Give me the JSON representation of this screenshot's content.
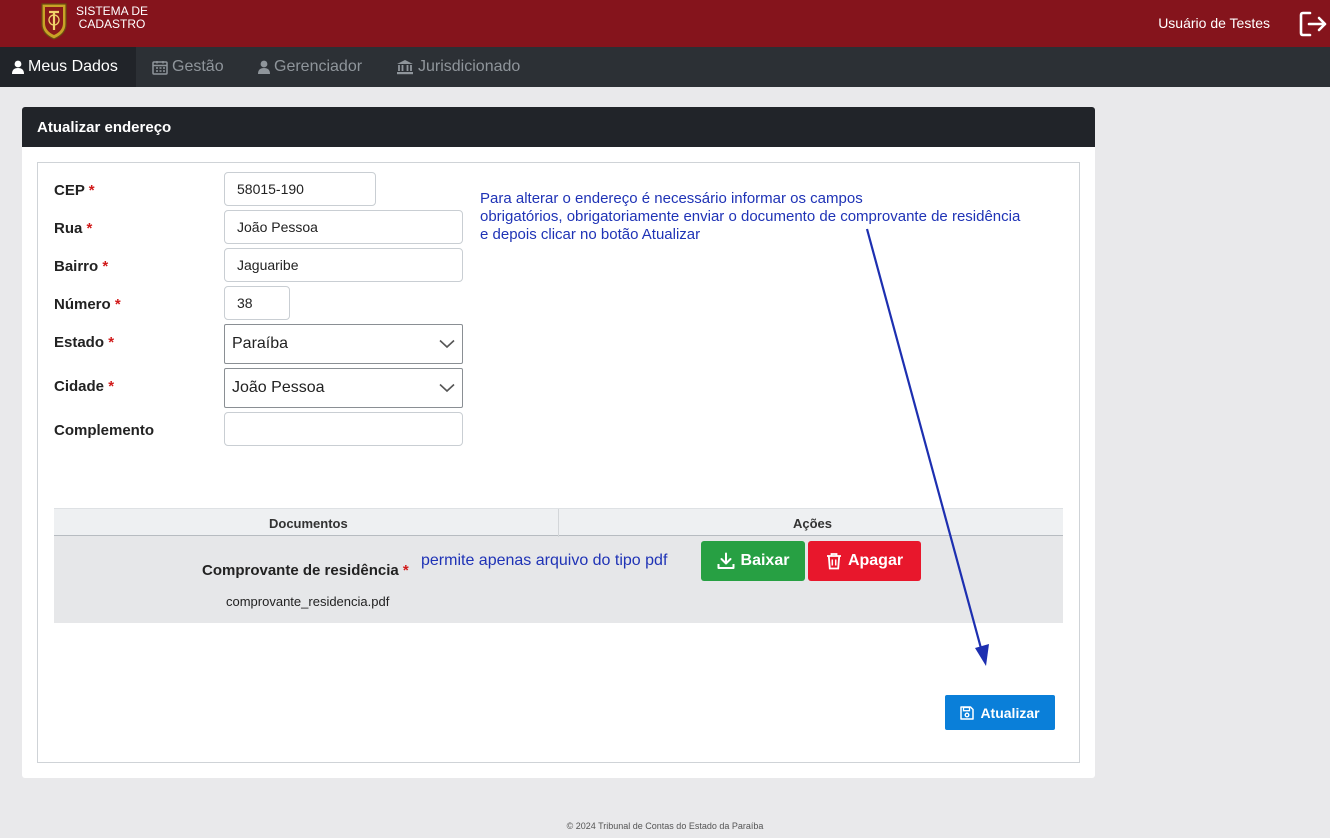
{
  "header": {
    "system_name_line1": "SISTEMA DE",
    "system_name_line2": "CADASTRO",
    "user_name": "Usuário de Testes",
    "logout_icon": "logout-icon",
    "brand_color": "#85141c"
  },
  "nav": {
    "items": [
      {
        "label": "Meus Dados",
        "icon": "user-icon",
        "active": true
      },
      {
        "label": "Gestão",
        "icon": "calendar-icon",
        "active": false
      },
      {
        "label": "Gerenciador",
        "icon": "user-icon",
        "active": false
      },
      {
        "label": "Jurisdicionado",
        "icon": "bank-icon",
        "active": false
      }
    ]
  },
  "card": {
    "title": "Atualizar endereço"
  },
  "form": {
    "cep": {
      "label": "CEP",
      "value": "58015-190"
    },
    "rua": {
      "label": "Rua",
      "value": "João Pessoa"
    },
    "bairro": {
      "label": "Bairro",
      "value": "Jaguaribe"
    },
    "numero": {
      "label": "Número",
      "value": "38"
    },
    "estado": {
      "label": "Estado",
      "value": "Paraíba"
    },
    "cidade": {
      "label": "Cidade",
      "value": "João Pessoa"
    },
    "complemento": {
      "label": "Complemento",
      "value": ""
    },
    "required_mark": "*"
  },
  "note": {
    "line1": "Para alterar o endereço é necessário informar os campos",
    "line2": "obrigatórios, obrigatoriamente enviar o documento de comprovante de residência",
    "line3": "e depois clicar no botão Atualizar"
  },
  "documents": {
    "col_documents": "Documentos",
    "col_actions": "Ações",
    "doc_label": "Comprovante de residência",
    "doc_file": "comprovante_residencia.pdf",
    "pdf_note": "permite apenas arquivo do tipo pdf",
    "download_label": "Baixar",
    "delete_label": "Apagar"
  },
  "actions": {
    "update_label": "Atualizar"
  },
  "footer": {
    "text": "© 2024 Tribunal de Contas do Estado da Paraíba"
  }
}
